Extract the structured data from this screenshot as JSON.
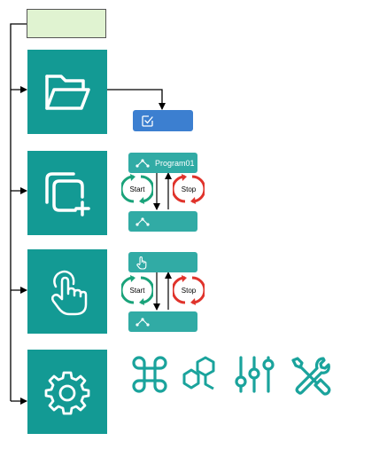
{
  "colors": {
    "tile": "#139a94",
    "bar": "#31aba5",
    "select_bar": "#3c7fd0",
    "top_box_fill": "#e0f3d1",
    "start_arrow": "#1aa37a",
    "stop_arrow": "#e0332b",
    "tool_icons": "#1aa39c"
  },
  "tiles": [
    {
      "icon": "folder-open-icon"
    },
    {
      "icon": "copy-add-icon"
    },
    {
      "icon": "hand-pointer-icon"
    },
    {
      "icon": "gear-icon"
    }
  ],
  "select_bar": {
    "icon": "checkbox-edit-icon"
  },
  "program_panel": {
    "top_label": "Program01",
    "start_label": "Start",
    "stop_label": "Stop"
  },
  "touch_panel": {
    "start_label": "Start",
    "stop_label": "Stop"
  },
  "tool_icons": [
    "apps-command-icon",
    "hexagon-nodes-icon",
    "sliders-icon",
    "tools-wrench-icon"
  ]
}
